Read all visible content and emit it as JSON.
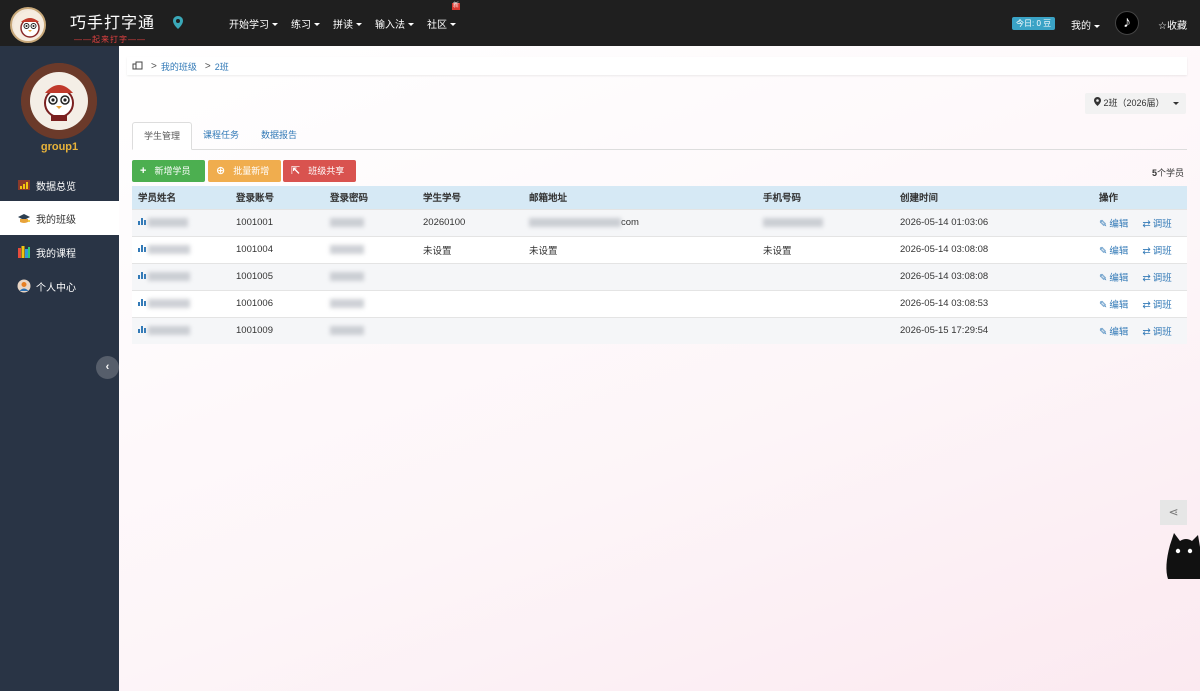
{
  "topbar": {
    "brand_name": "巧手打字通",
    "brand_sub": "——起来打字——",
    "nav": [
      {
        "label": "开始学习",
        "caret": true
      },
      {
        "label": "练习",
        "caret": true
      },
      {
        "label": "拼读",
        "caret": true
      },
      {
        "label": "输入法",
        "caret": true
      },
      {
        "label": "社区",
        "caret": true,
        "badge": "新"
      }
    ],
    "today_badge": "今日: 0 豆",
    "mine_label": "我的",
    "favorite_label": "☆收藏"
  },
  "sidebar": {
    "username": "group1",
    "items": [
      {
        "label": "数据总览",
        "icon": "chart-icon"
      },
      {
        "label": "我的班级",
        "icon": "class-icon",
        "active": true
      },
      {
        "label": "我的课程",
        "icon": "books-icon"
      },
      {
        "label": "个人中心",
        "icon": "user-icon"
      }
    ]
  },
  "breadcrumb": {
    "items": [
      "我的班级",
      "2班"
    ]
  },
  "class_select": {
    "value": "2班（2026届）"
  },
  "tabs": [
    {
      "label": "学生管理",
      "active": true
    },
    {
      "label": "课程任务"
    },
    {
      "label": "数据报告"
    }
  ],
  "buttons": {
    "add_student": "新增学员",
    "batch_add": "批量新增",
    "class_share": "班级共享"
  },
  "student_count": {
    "number": "5",
    "suffix": "个学员"
  },
  "table": {
    "headers": [
      "学员姓名",
      "登录账号",
      "登录密码",
      "学生学号",
      "邮箱地址",
      "手机号码",
      "创建时间",
      "操作"
    ],
    "rows": [
      {
        "account": "1001001",
        "student_no": "20260100",
        "email_suffix": "com",
        "phone": "",
        "created": "2026-05-14 01:03:06",
        "email_blur": true,
        "phone_blur": true
      },
      {
        "account": "1001004",
        "student_no": "未设置",
        "email_suffix": "未设置",
        "phone": "未设置",
        "created": "2026-05-14 03:08:08"
      },
      {
        "account": "1001005",
        "student_no": "",
        "email_suffix": "",
        "phone": "",
        "created": "2026-05-14 03:08:08"
      },
      {
        "account": "1001006",
        "student_no": "",
        "email_suffix": "",
        "phone": "",
        "created": "2026-05-14 03:08:53"
      },
      {
        "account": "1001009",
        "student_no": "",
        "email_suffix": "",
        "phone": "",
        "created": "2026-05-15 17:29:54"
      }
    ],
    "edit_label": "编辑",
    "transfer_label": "调班"
  },
  "colors": {
    "topbar": "#1f1f1f",
    "sidebar": "#293445",
    "username": "#e8b33a",
    "table_header": "#d6e9f5",
    "link": "#337ab7",
    "green": "#4caf50",
    "orange": "#f0ad4e",
    "red": "#d9534f"
  }
}
